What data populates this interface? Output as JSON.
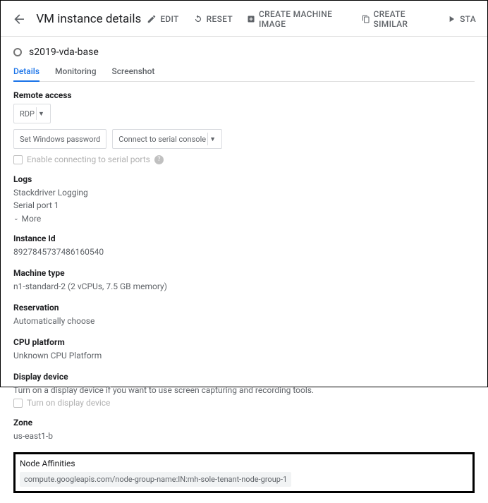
{
  "header": {
    "title": "VM instance details",
    "actions": {
      "edit": "EDIT",
      "reset": "RESET",
      "create_image": "CREATE MACHINE IMAGE",
      "create_similar": "CREATE SIMILAR",
      "start": "STA"
    }
  },
  "instance": {
    "name": "s2019-vda-base"
  },
  "tabs": {
    "details": "Details",
    "monitoring": "Monitoring",
    "screenshot": "Screenshot"
  },
  "remote_access": {
    "label": "Remote access",
    "rdp": "RDP",
    "set_password": "Set Windows password",
    "serial_console": "Connect to serial console",
    "enable_serial": "Enable connecting to serial ports"
  },
  "logs": {
    "label": "Logs",
    "stackdriver": "Stackdriver Logging",
    "serial_port": "Serial port 1",
    "more": "More"
  },
  "instance_id": {
    "label": "Instance Id",
    "value": "8927845737486160540"
  },
  "machine_type": {
    "label": "Machine type",
    "value": "n1-standard-2 (2 vCPUs, 7.5 GB memory)"
  },
  "reservation": {
    "label": "Reservation",
    "value": "Automatically choose"
  },
  "cpu_platform": {
    "label": "CPU platform",
    "value": "Unknown CPU Platform"
  },
  "display_device": {
    "label": "Display device",
    "desc": "Turn on a display device if you want to use screen capturing and recording tools.",
    "checkbox": "Turn on display device"
  },
  "zone": {
    "label": "Zone",
    "value": "us-east1-b"
  },
  "node_affinities": {
    "label": "Node Affinities",
    "value": "compute.googleapis.com/node-group-name:IN:mh-sole-tenant-node-group-1"
  }
}
